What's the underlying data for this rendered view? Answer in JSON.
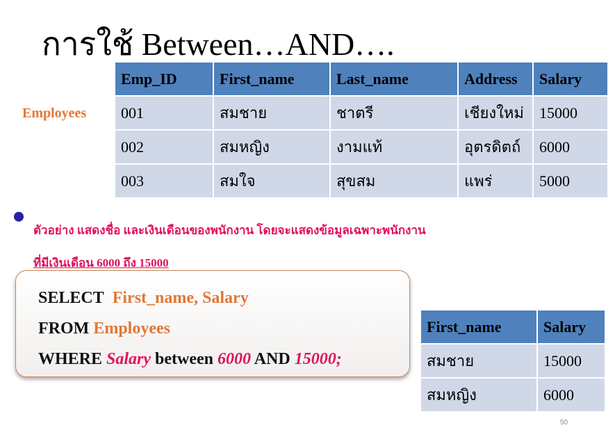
{
  "slide": {
    "title": "การใช้ Between…AND….",
    "side_label": "Employees",
    "page_number": "50"
  },
  "employees_table": {
    "headers": [
      "Emp_ID",
      "First_name",
      "Last_name",
      "Address",
      "Salary"
    ],
    "rows": [
      [
        "001",
        "สมชาย",
        "ชาตรี",
        "เชียงใหม่",
        "15000"
      ],
      [
        "002",
        "สมหญิง",
        "งามแท้",
        "อุตรดิตถ์",
        "6000"
      ],
      [
        "003",
        "สมใจ",
        "สุขสม",
        "แพร่",
        "5000"
      ]
    ]
  },
  "example": {
    "line1": "ตัวอย่าง  แสดงชื่อ และเงินเดือนของพนักงาน โดยจะแสดงข้อมูลเฉพาะพนักงาน",
    "line2": "ที่มีเงินเดือน 6000 ถึง 15000"
  },
  "sql": {
    "select_kw": "SELECT",
    "select_cols": "First_name, Salary",
    "from_kw": "FROM",
    "from_table": "Employees",
    "where_kw": "WHERE",
    "where_col": "Salary",
    "between_kw": "between",
    "low": "6000",
    "and_kw": "AND",
    "high": "15000;"
  },
  "result_table": {
    "headers": [
      "First_name",
      "Salary"
    ],
    "rows": [
      [
        "สมชาย",
        "15000"
      ],
      [
        "สมหญิง",
        "6000"
      ]
    ]
  },
  "colors": {
    "header_blue": "#4f81bd",
    "cell_light_blue": "#d0d8e8",
    "orange": "#e0783a",
    "magenta": "#e0115f",
    "bullet_blue": "#2a1fa6"
  }
}
